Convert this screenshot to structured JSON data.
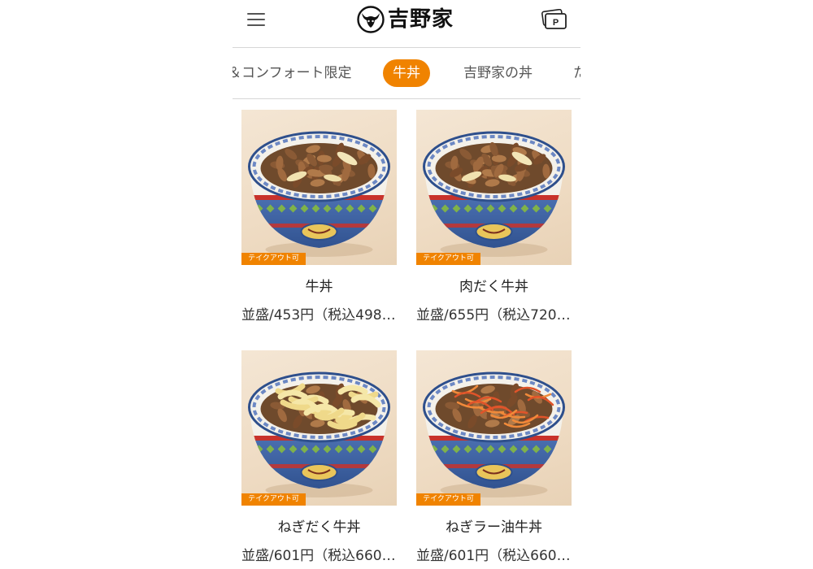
{
  "header": {
    "menu_icon": "hamburger-menu-icon",
    "logo_text": "吉野家",
    "point_icon": "point-card-icon",
    "point_label": "P"
  },
  "tabs": [
    {
      "label": "＆コンフォート限定",
      "active": false
    },
    {
      "label": "牛丼",
      "active": true
    },
    {
      "label": "吉野家の丼",
      "active": false
    },
    {
      "label": "た",
      "active": false
    }
  ],
  "menu_items": [
    {
      "name": "牛丼",
      "price": "並盛/453円（税込498…",
      "badge": "テイクアウト可",
      "topping": "beef"
    },
    {
      "name": "肉だく牛丼",
      "price": "並盛/655円（税込720…",
      "badge": "テイクアウト可",
      "topping": "beef-extra"
    },
    {
      "name": "ねぎだく牛丼",
      "price": "並盛/601円（税込660…",
      "badge": "テイクアウト可",
      "topping": "onion"
    },
    {
      "name": "ねぎラー油牛丼",
      "price": "並盛/601円（税込660…",
      "badge": "テイクアウト可",
      "topping": "chili-onion"
    }
  ],
  "colors": {
    "accent": "#f08300",
    "divider": "#d6d6d6"
  }
}
